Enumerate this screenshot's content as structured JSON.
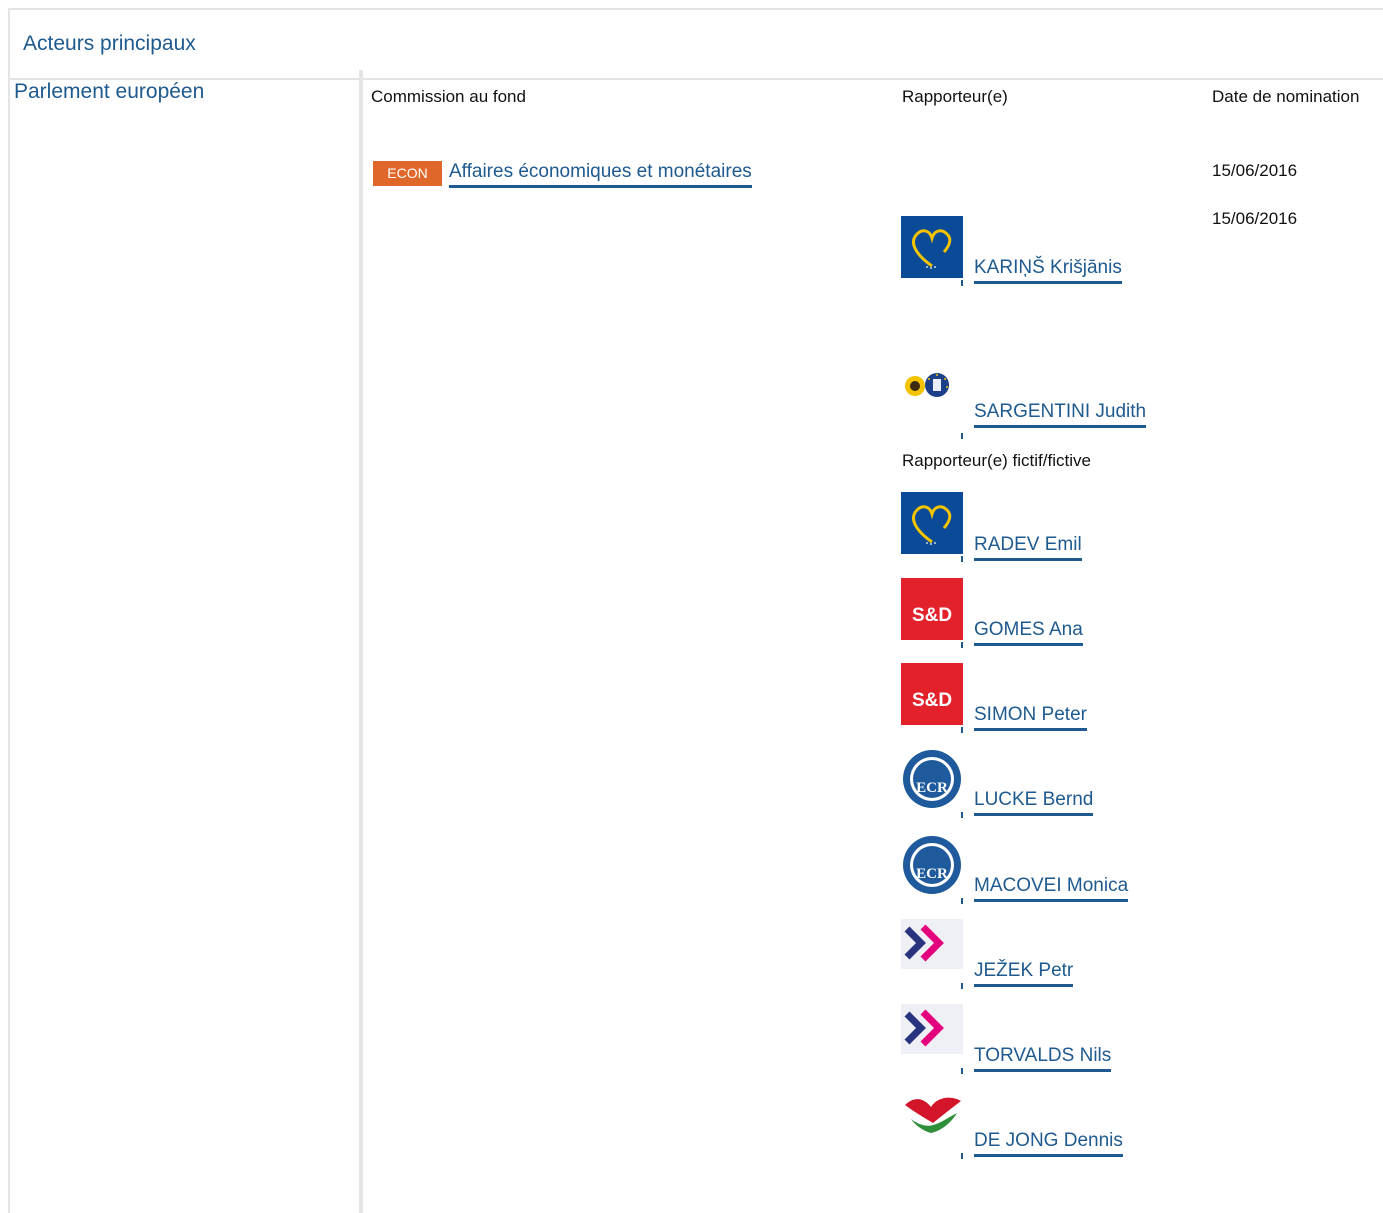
{
  "section": {
    "title": "Acteurs principaux",
    "institution": "Parlement européen"
  },
  "headers": {
    "committee": "Commission au fond",
    "rapporteur": "Rapporteur(e)",
    "date": "Date de nomination"
  },
  "committee": {
    "badge": "ECON",
    "name": "Affaires économiques et monétaires",
    "badge_color": "#e0672a"
  },
  "dates": [
    "15/06/2016",
    "15/06/2016"
  ],
  "rapporteurs": [
    {
      "name": "KARIŅŠ Krišjānis",
      "group_icon": "epp-logo-icon"
    },
    {
      "name": "SARGENTINI Judith",
      "group_icon": "greens-efa-logo-icon"
    }
  ],
  "shadow_label": "Rapporteur(e) fictif/fictive",
  "shadow_rapporteurs": [
    {
      "name": "RADEV Emil",
      "group_icon": "epp-logo-icon"
    },
    {
      "name": "GOMES Ana",
      "group_icon": "sd-logo-icon"
    },
    {
      "name": "SIMON Peter",
      "group_icon": "sd-logo-icon"
    },
    {
      "name": "LUCKE Bernd",
      "group_icon": "ecr-logo-icon"
    },
    {
      "name": "MACOVEI Monica",
      "group_icon": "ecr-logo-icon"
    },
    {
      "name": "JEŽEK Petr",
      "group_icon": "alde-logo-icon"
    },
    {
      "name": "TORVALDS Nils",
      "group_icon": "alde-logo-icon"
    },
    {
      "name": "DE JONG Dennis",
      "group_icon": "gue-ngl-logo-icon"
    }
  ],
  "sd_logo_text": "S&D",
  "ecr_logo_text": "ECR",
  "colors": {
    "link": "#1f5a8f",
    "epp_blue": "#0a4a96",
    "sd_red": "#e3212b",
    "ecr_blue": "#1f5a9c",
    "alde_blue": "#28347d",
    "alde_pink": "#e3007d"
  }
}
